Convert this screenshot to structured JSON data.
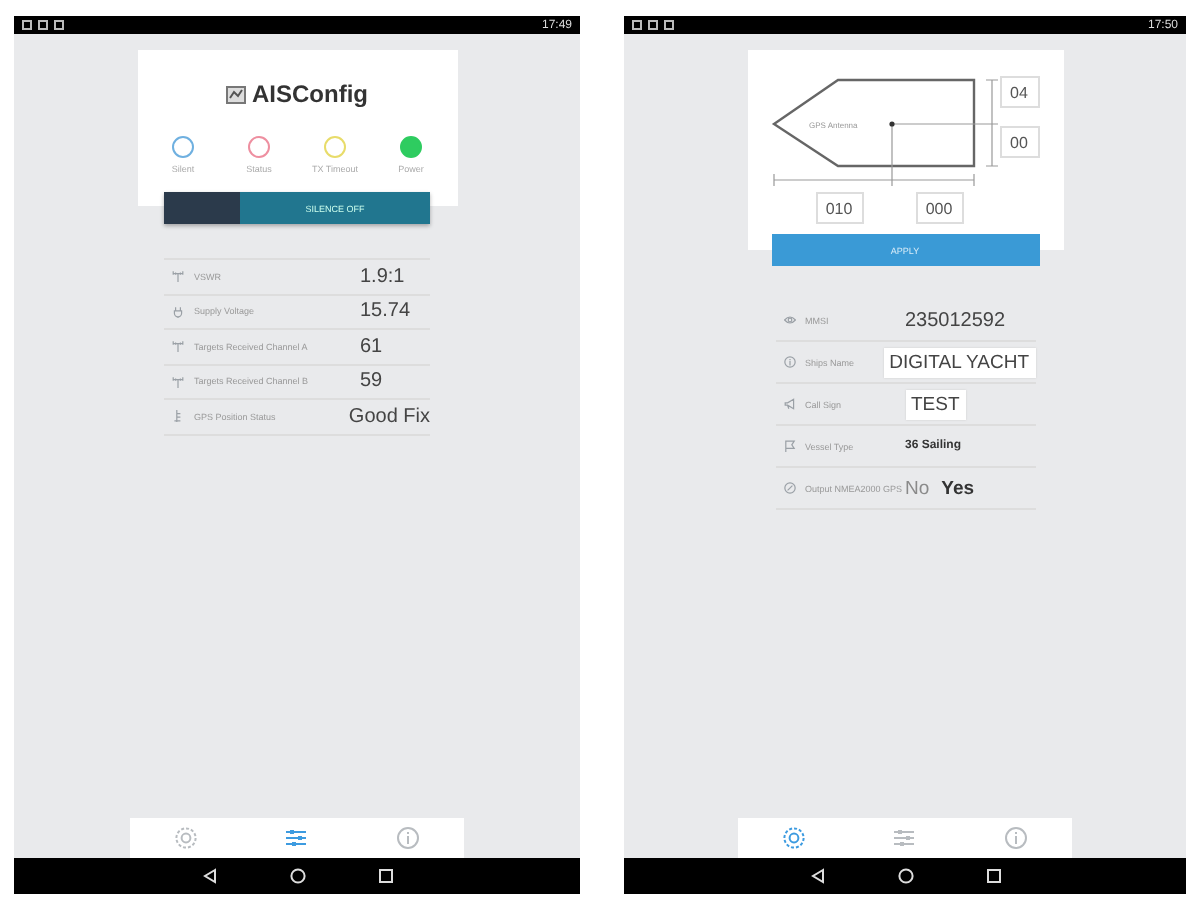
{
  "status_screen": {
    "status_bar": {
      "time": "17:49"
    },
    "title": "AISConfig",
    "indicators": [
      {
        "label": "Silent",
        "color": "#6fb0e0",
        "on": false
      },
      {
        "label": "Status",
        "color": "#ee8fa0",
        "on": false
      },
      {
        "label": "TX Timeout",
        "color": "#e8dc6a",
        "on": false
      },
      {
        "label": "Power",
        "color": "#2ecc60",
        "on": true
      }
    ],
    "silence_switch": {
      "label": "SILENCE OFF",
      "on": false
    },
    "rows": [
      {
        "kind": "antenna",
        "label": "VSWR",
        "value": "1.9:1"
      },
      {
        "kind": "plug",
        "label": "Supply Voltage",
        "value": "15.74"
      },
      {
        "kind": "antenna",
        "label": "Targets Received Channel A",
        "value": "61"
      },
      {
        "kind": "antenna",
        "label": "Targets Received Channel B",
        "value": "59"
      },
      {
        "kind": "gps",
        "label": "GPS Position Status",
        "value": "Good Fix"
      }
    ],
    "tabs": [
      {
        "kind": "gear",
        "selected": false
      },
      {
        "kind": "sliders",
        "selected": true
      },
      {
        "kind": "info",
        "selected": false
      }
    ]
  },
  "settings_screen": {
    "status_bar": {
      "time": "17:50"
    },
    "diagram": {
      "antenna_label": "GPS Antenna",
      "starboard": "04",
      "port": "00",
      "bow": "010",
      "stern": "000"
    },
    "apply_button": "APPLY",
    "rows": [
      {
        "kind": "text",
        "label": "MMSI",
        "value": "235012592"
      },
      {
        "kind": "input",
        "label": "Ships Name",
        "value": "DIGITAL YACHT"
      },
      {
        "kind": "input",
        "label": "Call Sign",
        "value": "TEST"
      },
      {
        "kind": "select",
        "label": "Vessel Type",
        "value": "36 Sailing"
      },
      {
        "kind": "choice",
        "label": "Output NMEA2000 GPS",
        "options": [
          {
            "label": "No",
            "selected": false
          },
          {
            "label": "Yes",
            "selected": true
          }
        ]
      }
    ],
    "tabs": [
      {
        "kind": "gear",
        "selected": true
      },
      {
        "kind": "sliders",
        "selected": false
      },
      {
        "kind": "info",
        "selected": false
      }
    ]
  }
}
